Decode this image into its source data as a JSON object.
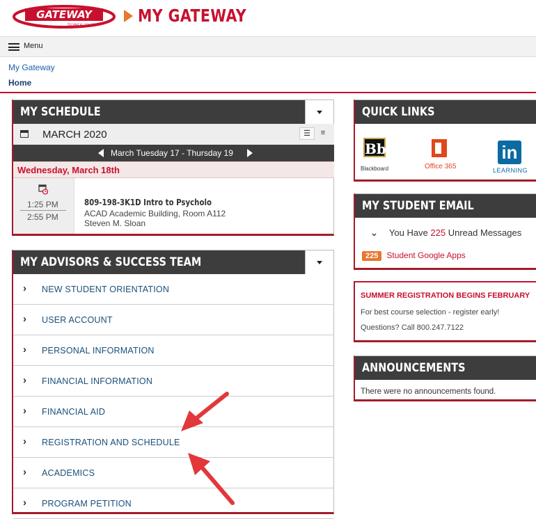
{
  "header": {
    "logo_text": "GATEWAY",
    "logo_subtext": "TECHNICAL COLLEGE",
    "site_title": "MY GATEWAY"
  },
  "menubar": {
    "menu_label": "Menu"
  },
  "breadcrumb": {
    "parent": "My Gateway",
    "current": "Home"
  },
  "schedule": {
    "title": "MY SCHEDULE",
    "month": "MARCH 2020",
    "range": "March Tuesday 17 - Thursday 19",
    "day": "Wednesday, March 18th",
    "event": {
      "start": "1:25 PM",
      "end": "2:55 PM",
      "course": "809-198-3K1D Intro to Psycholo",
      "location": "ACAD Academic Building, Room A112",
      "instructor": "Steven M. Sloan"
    }
  },
  "advisors": {
    "title": "MY ADVISORS & SUCCESS TEAM",
    "items": [
      {
        "label": "NEW STUDENT ORIENTATION"
      },
      {
        "label": "USER ACCOUNT"
      },
      {
        "label": "PERSONAL INFORMATION"
      },
      {
        "label": "FINANCIAL INFORMATION"
      },
      {
        "label": "FINANCIAL AID"
      },
      {
        "label": "REGISTRATION AND SCHEDULE"
      },
      {
        "label": "ACADEMICS"
      },
      {
        "label": "PROGRAM PETITION"
      }
    ]
  },
  "quick_links": {
    "title": "QUICK LINKS",
    "blackboard_icon": "Bb",
    "blackboard_label": "Blackboard",
    "office_label": "Office 365",
    "linkedin_icon": "in",
    "linkedin_label": "LEARNING"
  },
  "email": {
    "title": "MY STUDENT EMAIL",
    "prefix": "You Have ",
    "count": "225",
    "suffix": " Unread Messages",
    "badge": "225",
    "link": "Student Google Apps"
  },
  "summer": {
    "title": "SUMMER REGISTRATION BEGINS FEBRUARY",
    "line1": "For best course selection - register early!",
    "line2": "Questions? Call 800.247.7122"
  },
  "announcements": {
    "title": "ANNOUNCEMENTS",
    "empty_text": "There were no announcements found."
  },
  "colors": {
    "brand_red": "#c8102e",
    "dark_header": "#3d3d3d",
    "link_blue": "#1a4f7a",
    "annotation_arrow": "#e2383b"
  }
}
